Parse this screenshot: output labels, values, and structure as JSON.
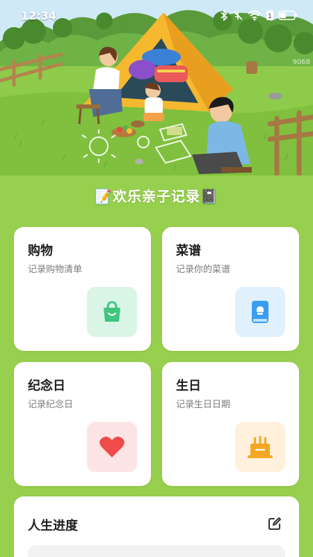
{
  "status": {
    "time": "12:34",
    "watermark": "9068"
  },
  "app": {
    "title": "📝欢乐亲子记录📓"
  },
  "cards": {
    "shopping": {
      "title": "购物",
      "subtitle": "记录购物清单",
      "icon": "shopping-bag-icon",
      "icon_bg": "#d9f5e6",
      "icon_color": "#3fc680"
    },
    "recipe": {
      "title": "菜谱",
      "subtitle": "记录你的菜谱",
      "icon": "recipe-book-icon",
      "icon_bg": "#e0f1fd",
      "icon_color": "#3a9ef0"
    },
    "anniversary": {
      "title": "纪念日",
      "subtitle": "记录纪念日",
      "icon": "heart-icon",
      "icon_bg": "#fde4e4",
      "icon_color": "#ef4b4b"
    },
    "birthday": {
      "title": "生日",
      "subtitle": "记录生日日期",
      "icon": "birthday-cake-icon",
      "icon_bg": "#fff1dc",
      "icon_color": "#f5a623"
    }
  },
  "progress": {
    "title": "人生进度"
  },
  "colors": {
    "background": "#97cf4e",
    "card": "#ffffff"
  }
}
